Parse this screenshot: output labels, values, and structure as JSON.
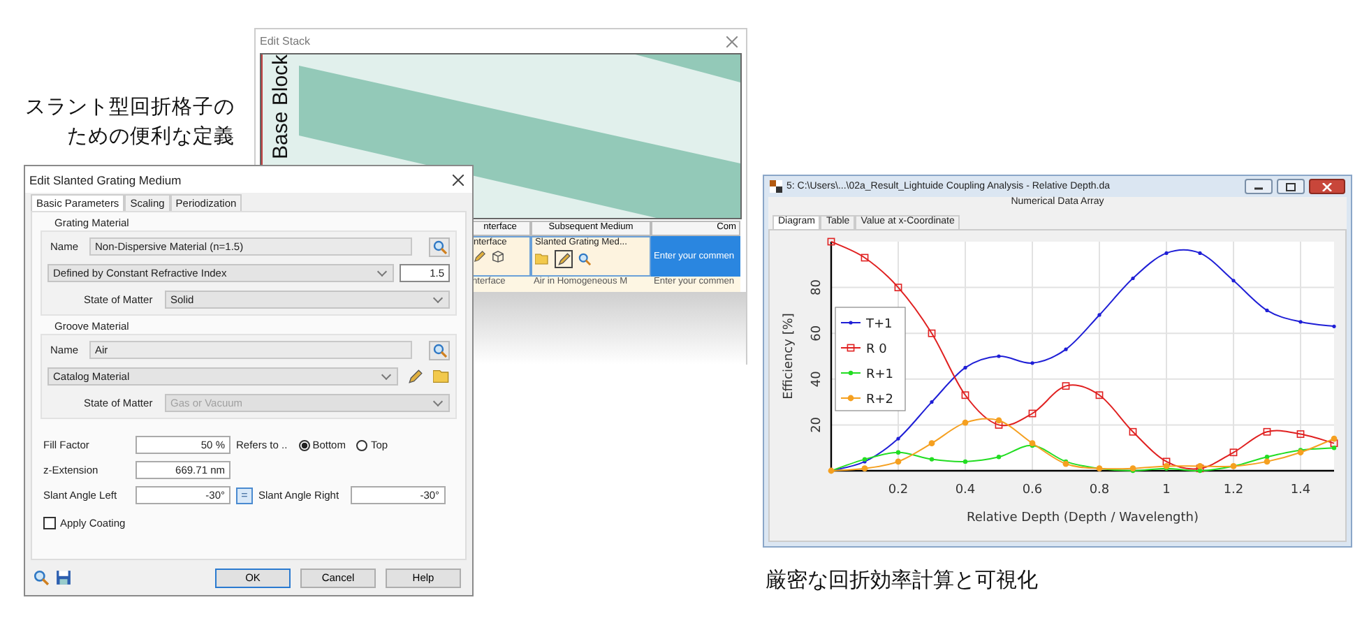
{
  "left_caption": [
    "スラント型回折格子の",
    "ための便利な定義"
  ],
  "edit_stack": {
    "title": "Edit Stack",
    "base_block": "Base Block",
    "columns": [
      "nterface",
      "Subsequent Medium",
      "Com"
    ],
    "rows": [
      {
        "selected": true,
        "cells": [
          "nterface",
          "Slanted Grating Med...",
          "Enter your commen"
        ]
      },
      {
        "selected": false,
        "cells": [
          "nterface",
          "Air in Homogeneous M",
          "Enter your commen"
        ]
      }
    ]
  },
  "dialog": {
    "title": "Edit Slanted Grating Medium",
    "tabs": [
      {
        "label": "Basic Parameters",
        "selected": true
      },
      {
        "label": "Scaling",
        "selected": false
      },
      {
        "label": "Periodization",
        "selected": false
      }
    ],
    "groups": [
      {
        "title": "Grating Material",
        "name_label": "Name",
        "name": "Non-Dispersive Material (n=1.5)",
        "definition": "Defined by Constant Refractive Index",
        "index": "1.5",
        "state_label": "State of Matter",
        "state": "Solid",
        "state_disabled": false
      },
      {
        "title": "Groove Material",
        "name_label": "Name",
        "name": "Air",
        "definition": "Catalog Material",
        "state_label": "State of Matter",
        "state": "Gas or Vacuum",
        "state_disabled": true
      }
    ],
    "fill_factor": {
      "label": "Fill Factor",
      "value": "50 %",
      "refers_label": "Refers to ..",
      "options": [
        {
          "label": "Bottom",
          "selected": true
        },
        {
          "label": "Top",
          "selected": false
        }
      ]
    },
    "z_extension": {
      "label": "z-Extension",
      "value": "669.71 nm"
    },
    "slant_left": {
      "label": "Slant Angle Left",
      "value": "-30°"
    },
    "equal_button": "=",
    "slant_right": {
      "label": "Slant Angle Right",
      "value": "-30°"
    },
    "apply_coating": {
      "label": "Apply Coating",
      "checked": false
    },
    "buttons": [
      "OK",
      "Cancel",
      "Help"
    ]
  },
  "chart_window": {
    "title": "5: C:\\Users\\...\\02a_Result_Lightuide Coupling Analysis - Relative Depth.da",
    "subtitle": "Numerical Data Array",
    "tabs": [
      {
        "label": "Diagram",
        "selected": true
      },
      {
        "label": "Table",
        "selected": false
      },
      {
        "label": "Value at x-Coordinate",
        "selected": false
      }
    ],
    "chart_data": {
      "type": "line",
      "xlabel": "Relative Depth (Depth / Wavelength)",
      "ylabel": "Efficiency [%]",
      "x": [
        0,
        0.1,
        0.2,
        0.3,
        0.4,
        0.5,
        0.6,
        0.7,
        0.8,
        0.9,
        1.0,
        1.1,
        1.2,
        1.3,
        1.4,
        1.5
      ],
      "series": [
        {
          "name": "T+1",
          "color": "#1f1fd6",
          "values": [
            0,
            4,
            14,
            30,
            45,
            50,
            47,
            53,
            68,
            84,
            95,
            95,
            83,
            70,
            65,
            63
          ]
        },
        {
          "name": "R 0",
          "color": "#e02020",
          "values": [
            100,
            93,
            80,
            60,
            33,
            20,
            25,
            37,
            33,
            17,
            4,
            1,
            8,
            17,
            16,
            12
          ]
        },
        {
          "name": "R+1",
          "color": "#22dd22",
          "values": [
            0,
            5,
            8,
            5,
            4,
            6,
            11,
            4,
            1,
            0,
            1,
            0,
            2,
            6,
            9,
            10
          ]
        },
        {
          "name": "R+2",
          "color": "#f5a020",
          "values": [
            0,
            1,
            4,
            12,
            21,
            22,
            12,
            3,
            1,
            1,
            2,
            2,
            2,
            4,
            8,
            14
          ]
        }
      ],
      "grid": true,
      "legend": true,
      "xlim": [
        0,
        1.5
      ],
      "ylim": [
        0,
        100
      ],
      "xticks": [
        0.2,
        0.4,
        0.6,
        0.8,
        1,
        1.2,
        1.4
      ],
      "yticks": [
        20,
        40,
        60,
        80
      ]
    }
  },
  "bottom_caption": "厳密な回折効率計算と可視化"
}
